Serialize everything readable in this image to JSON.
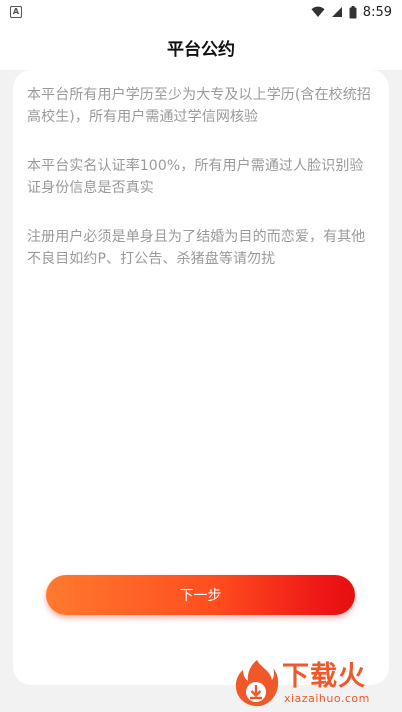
{
  "status_bar": {
    "time": "8:59",
    "app_icon": "A",
    "icons": [
      "wifi-icon",
      "signal-icon",
      "battery-icon"
    ]
  },
  "app_bar": {
    "title": "平台公约"
  },
  "content": {
    "paragraphs": [
      "本平台所有用户学历至少为大专及以上学历(含在校统招高校生)，所有用户需通过学信网核验",
      "本平台实名认证率100%，所有用户需通过人脸识别验证身份信息是否真实",
      "注册用户必须是单身且为了结婚为目的而恋爱，有其他不良目如约P、打公告、杀猪盘等请勿扰"
    ]
  },
  "next_button": {
    "label": "下一步"
  },
  "watermark": {
    "brand": "下载火",
    "url": "xiazaihuo.com"
  },
  "colors": {
    "background": "#f2f2f2",
    "card": "#ffffff",
    "text_muted": "#9a9a9a",
    "button_start": "#ff7a2e",
    "button_end": "#e60f0f",
    "watermark": "#f0582a"
  }
}
